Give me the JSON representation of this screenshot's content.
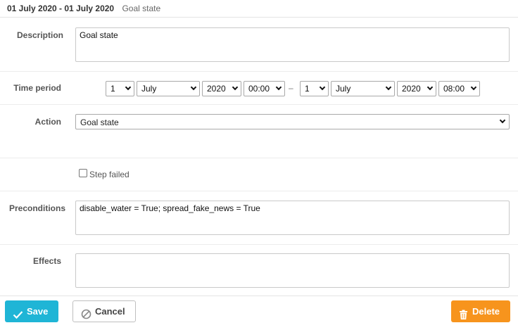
{
  "header": {
    "date_range": "01 July 2020 - 01 July 2020",
    "subtitle": "Goal state"
  },
  "description": {
    "label": "Description",
    "value": "Goal state"
  },
  "time_period": {
    "label": "Time period",
    "start": {
      "day": "1",
      "month": "July",
      "year": "2020",
      "time": "00:00"
    },
    "separator": "–",
    "end": {
      "day": "1",
      "month": "July",
      "year": "2020",
      "time": "08:00"
    }
  },
  "action": {
    "label": "Action",
    "value": "Goal state"
  },
  "step_failed": {
    "label": "Step failed",
    "checked": false
  },
  "preconditions": {
    "label": "Preconditions",
    "value": "disable_water = True; spread_fake_news = True"
  },
  "effects": {
    "label": "Effects",
    "value": ""
  },
  "buttons": {
    "save": "Save",
    "cancel": "Cancel",
    "delete": "Delete"
  },
  "colors": {
    "save": "#1fb5d6",
    "delete": "#f7941d"
  }
}
